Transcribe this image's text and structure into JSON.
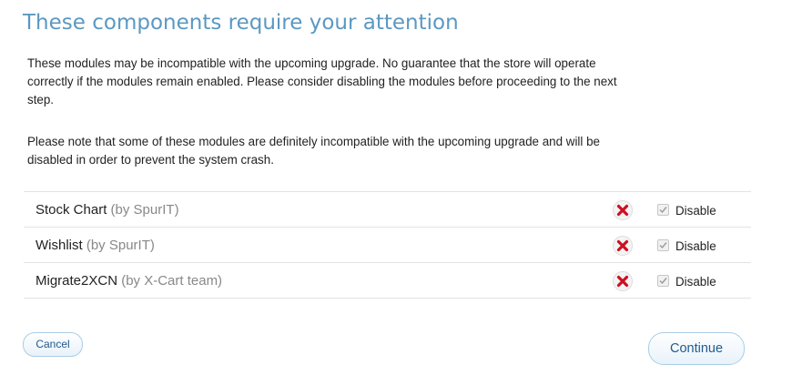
{
  "page": {
    "title": "These components require your attention",
    "paragraph1": "These modules may be incompatible with the upcoming upgrade. No guarantee that the store will operate correctly if the modules remain enabled. Please consider disabling the modules before proceeding to the next step.",
    "paragraph2": "Please note that some of these modules are definitely incompatible with the upcoming upgrade and will be disabled in order to prevent the system crash."
  },
  "modules": [
    {
      "name": "Stock Chart",
      "author": "(by SpurIT)",
      "status_icon": "incompatible-x-icon",
      "disable_label": "Disable",
      "disable_checked": true,
      "disable_enabled": false
    },
    {
      "name": "Wishlist",
      "author": "(by SpurIT)",
      "status_icon": "incompatible-x-icon",
      "disable_label": "Disable",
      "disable_checked": true,
      "disable_enabled": false
    },
    {
      "name": "Migrate2XCN",
      "author": "(by X-Cart team)",
      "status_icon": "incompatible-x-icon",
      "disable_label": "Disable",
      "disable_checked": true,
      "disable_enabled": false
    }
  ],
  "buttons": {
    "cancel": "Cancel",
    "continue": "Continue"
  },
  "colors": {
    "title": "#5b98c2",
    "button_text": "#1f5b8e",
    "button_border": "#a9cde6",
    "x_icon": "#cc1122"
  }
}
